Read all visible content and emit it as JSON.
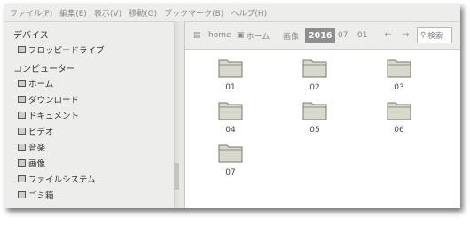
{
  "menubar": [
    "ファイル(F)",
    "編集(E)",
    "表示(V)",
    "移動(G)",
    "ブックマーク(B)",
    "ヘルプ(H)"
  ],
  "sidebar": {
    "devices_heading": "デバイス",
    "devices": [
      {
        "label": "フロッピードライブ",
        "icon": "floppy-drive-icon"
      }
    ],
    "computer_heading": "コンピューター",
    "computer": [
      {
        "label": "ホーム",
        "icon": "home-folder-icon"
      },
      {
        "label": "ダウンロード",
        "icon": "folder-icon"
      },
      {
        "label": "ドキュメント",
        "icon": "folder-icon"
      },
      {
        "label": "ビデオ",
        "icon": "folder-icon"
      },
      {
        "label": "音楽",
        "icon": "folder-icon"
      },
      {
        "label": "画像",
        "icon": "folder-icon"
      },
      {
        "label": "ファイルシステム",
        "icon": "drive-icon"
      },
      {
        "label": "ゴミ箱",
        "icon": "trash-icon"
      }
    ]
  },
  "toolbar": {
    "breadcrumbs": [
      "home",
      "ホーム",
      "画像",
      "2016",
      "07",
      "01"
    ],
    "active_crumb": "2016",
    "search_placeholder": "検索"
  },
  "folders": [
    "01",
    "02",
    "03",
    "04",
    "05",
    "06",
    "07"
  ],
  "colors": {
    "folder_body": "#d8d8cc",
    "folder_outline": "#7a7a6e",
    "active_crumb": "#8f8f8f"
  }
}
